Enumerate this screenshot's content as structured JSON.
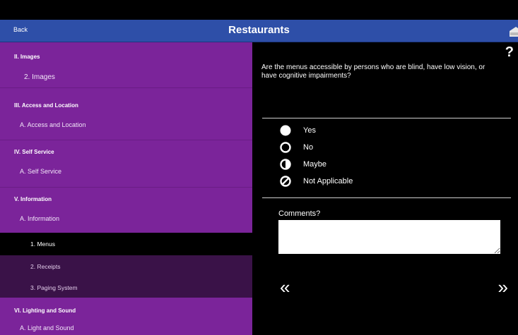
{
  "navbar": {
    "back_label": "Back",
    "title": "Restaurants",
    "home_icon": "home-icon"
  },
  "sidebar": {
    "items": [
      {
        "label": "II. Images",
        "kind": "section"
      },
      {
        "label": "2. Images",
        "kind": "item"
      },
      {
        "label": "III. Access and Location",
        "kind": "section"
      },
      {
        "label": "A. Access and Location",
        "kind": "sub"
      },
      {
        "label": "IV. Self Service",
        "kind": "section"
      },
      {
        "label": "A. Self Service",
        "kind": "sub"
      },
      {
        "label": "V. Information",
        "kind": "section"
      },
      {
        "label": "A. Information",
        "kind": "sub"
      },
      {
        "label": "1. Menus",
        "kind": "item",
        "state": "selected"
      },
      {
        "label": "2. Receipts",
        "kind": "item"
      },
      {
        "label": "3. Paging System",
        "kind": "item"
      },
      {
        "label": "VI. Lighting and Sound",
        "kind": "section"
      },
      {
        "label": "A. Light and Sound",
        "kind": "sub"
      }
    ]
  },
  "main": {
    "help_glyph": "?",
    "question": "Are the menus accessible by persons who are blind, have low vision, or have cognitive impairments?",
    "options": [
      {
        "label": "Yes",
        "icon": "filled-circle-icon",
        "selected": true
      },
      {
        "label": "No",
        "icon": "empty-circle-icon"
      },
      {
        "label": "Maybe",
        "icon": "half-circle-icon"
      },
      {
        "label": "Not Applicable",
        "icon": "slashed-circle-icon"
      }
    ],
    "comments_label": "Comments?",
    "comments_value": "",
    "prev_glyph": "«",
    "next_glyph": "»"
  }
}
